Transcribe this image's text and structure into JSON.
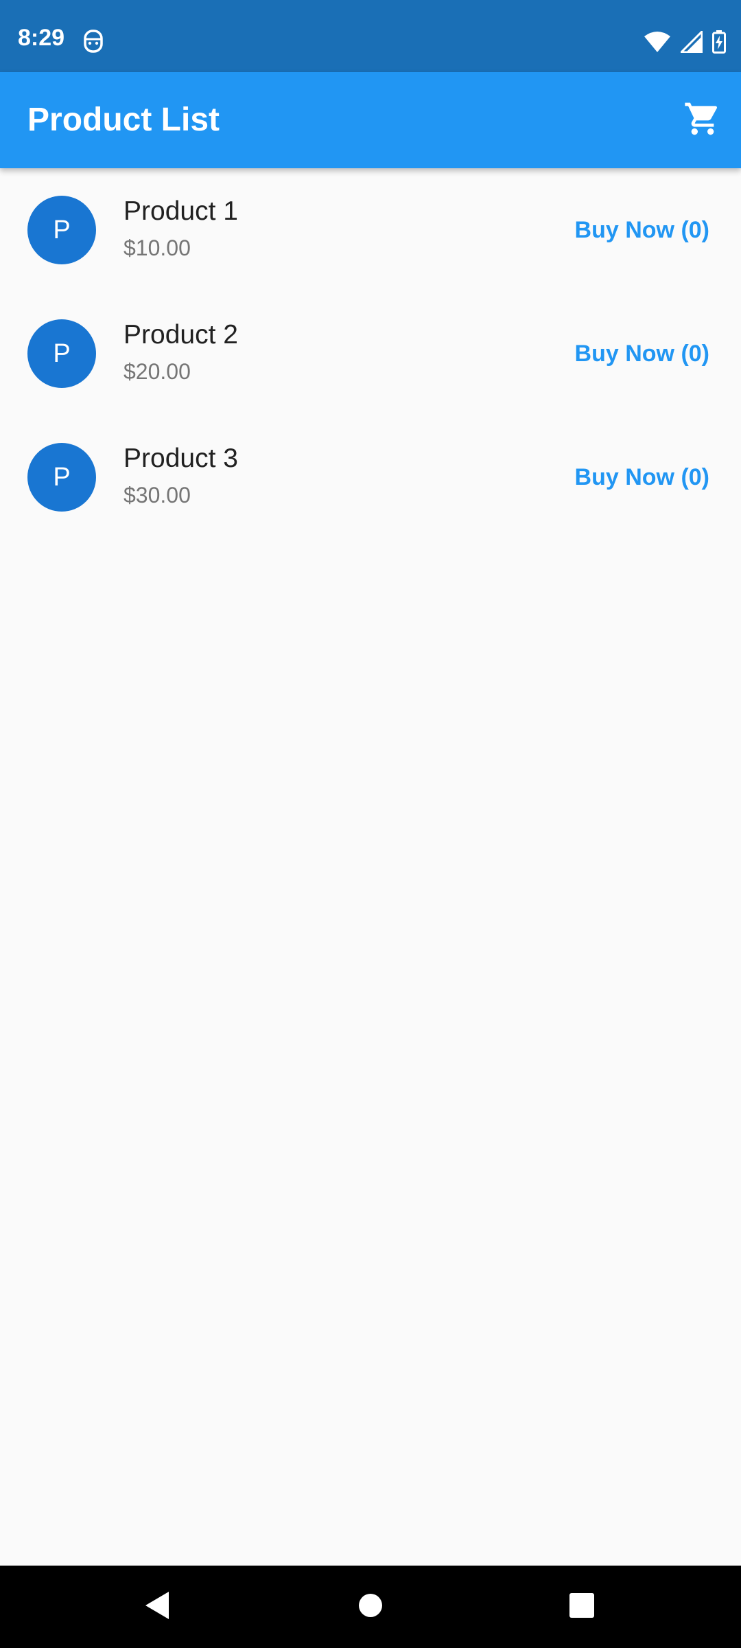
{
  "status_bar": {
    "time": "8:29",
    "icons": [
      "notification-icon",
      "wifi-icon",
      "cell-signal-icon",
      "battery-charging-icon"
    ]
  },
  "app_bar": {
    "title": "Product List",
    "action_icon": "shopping-cart-icon"
  },
  "products": [
    {
      "avatar_letter": "P",
      "name": "Product 1",
      "price": "$10.00",
      "buy_label": "Buy Now (0)"
    },
    {
      "avatar_letter": "P",
      "name": "Product 2",
      "price": "$20.00",
      "buy_label": "Buy Now (0)"
    },
    {
      "avatar_letter": "P",
      "name": "Product 3",
      "price": "$30.00",
      "buy_label": "Buy Now (0)"
    }
  ],
  "nav_bar": {
    "icons": [
      "back-icon",
      "home-icon",
      "recents-icon"
    ]
  },
  "colors": {
    "status_bar": "#1a6fb6",
    "app_bar": "#2196f3",
    "avatar": "#1976d2",
    "accent_text": "#2196f3",
    "background": "#fafafa"
  }
}
